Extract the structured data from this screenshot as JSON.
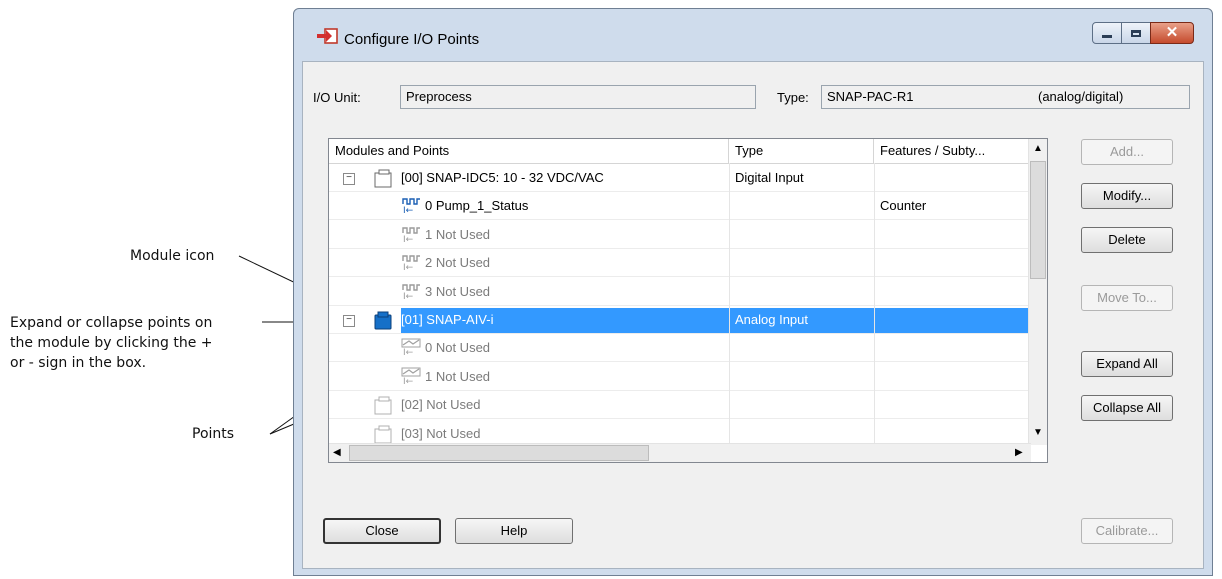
{
  "callouts": {
    "module_icon": "Module icon",
    "expand_line1": "Expand or collapse points on",
    "expand_line2": "the module by clicking the +",
    "expand_line3": "or - sign in the box.",
    "points": "Points"
  },
  "window": {
    "title": "Configure I/O Points",
    "icon": "io-arrow-icon",
    "buttons": [
      "minimize-icon",
      "maximize-icon",
      "close-icon"
    ]
  },
  "io_unit": {
    "label": "I/O Unit:",
    "value": "Preprocess"
  },
  "type_field": {
    "label": "Type:",
    "value": "SNAP-PAC-R1",
    "suffix": "(analog/digital)"
  },
  "table": {
    "columns": [
      "Modules and Points",
      "Type",
      "Features / Subty..."
    ],
    "rows": [
      {
        "kind": "module",
        "expander": "⊟",
        "name": "[00] SNAP-IDC5: 10 - 32 VDC/VAC",
        "type": "Digital Input",
        "features": "",
        "dim": false,
        "selected": false
      },
      {
        "kind": "point-digital",
        "name": "0  Pump_1_Status",
        "type": "",
        "features": "Counter",
        "dim": false,
        "selected": false
      },
      {
        "kind": "point-digital",
        "name": "1  Not Used",
        "type": "",
        "features": "",
        "dim": true,
        "selected": false
      },
      {
        "kind": "point-digital",
        "name": "2  Not Used",
        "type": "",
        "features": "",
        "dim": true,
        "selected": false
      },
      {
        "kind": "point-digital",
        "name": "3  Not Used",
        "type": "",
        "features": "",
        "dim": true,
        "selected": false
      },
      {
        "kind": "module-analog",
        "expander": "⊟",
        "name": "[01] SNAP-AIV-i",
        "type": "Analog Input",
        "features": "",
        "dim": false,
        "selected": true
      },
      {
        "kind": "point-analog",
        "name": "0  Not Used",
        "type": "",
        "features": "",
        "dim": true,
        "selected": false
      },
      {
        "kind": "point-analog",
        "name": "1  Not Used",
        "type": "",
        "features": "",
        "dim": true,
        "selected": false
      },
      {
        "kind": "module-empty",
        "name": "[02] Not Used",
        "type": "",
        "features": "",
        "dim": true,
        "selected": false
      },
      {
        "kind": "module-empty",
        "name": "[03] Not Used",
        "type": "",
        "features": "",
        "dim": true,
        "selected": false
      }
    ]
  },
  "side_buttons": {
    "add": "Add...",
    "modify": "Modify...",
    "delete": "Delete",
    "move_to": "Move To...",
    "expand_all": "Expand All",
    "collapse_all": "Collapse All",
    "calibrate": "Calibrate..."
  },
  "bottom_buttons": {
    "close": "Close",
    "help": "Help"
  },
  "colors": {
    "selection": "#3399ff",
    "window_frame": "#cfdcec",
    "digital_icon": "#1a5fb4",
    "module_blue": "#1670c8"
  }
}
